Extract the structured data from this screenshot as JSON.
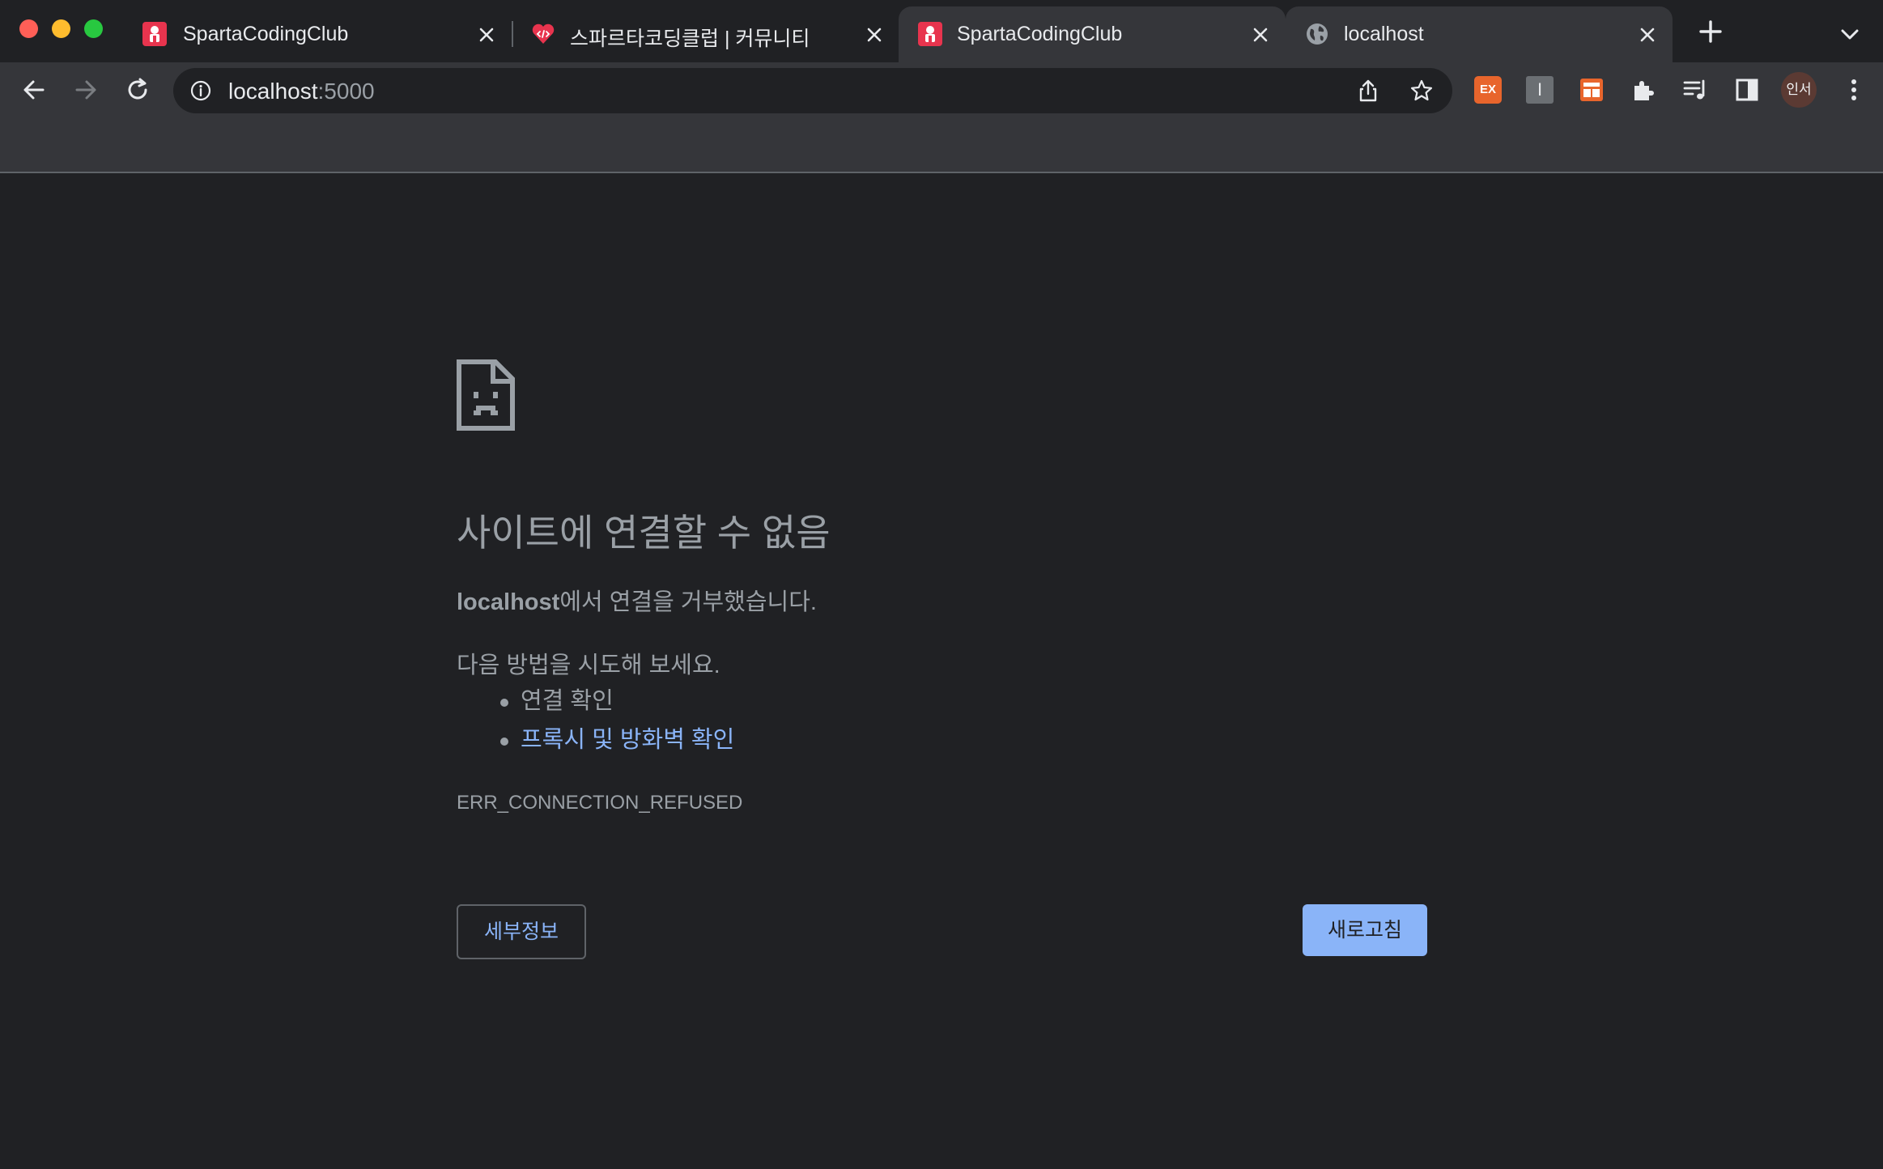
{
  "browser": {
    "tabs": [
      {
        "title": "SpartaCodingClub",
        "icon": "sparta-favicon-icon",
        "active": false
      },
      {
        "title": "스파르타코딩클럽 | 커뮤니티",
        "icon": "community-favicon-icon",
        "active": false
      },
      {
        "title": "SpartaCodingClub",
        "icon": "sparta-favicon-icon",
        "active": false
      },
      {
        "title": "localhost",
        "icon": "globe-icon",
        "active": true
      }
    ],
    "omnibox": {
      "host": "localhost",
      "port": ":5000"
    },
    "extensions": {
      "ex_label": "EX",
      "i_label": "I"
    },
    "profile_label": "인서"
  },
  "error_page": {
    "heading": "사이트에 연결할 수 없음",
    "host": "localhost",
    "refused_text": "에서 연결을 거부했습니다.",
    "try_text": "다음 방법을 시도해 보세요.",
    "suggestions": [
      "연결 확인",
      "프록시 및 방화벽 확인"
    ],
    "error_code": "ERR_CONNECTION_REFUSED",
    "details_button": "세부정보",
    "reload_button": "새로고침"
  },
  "colors": {
    "background": "#202124",
    "toolbar": "#35363a",
    "link": "#8ab4f8",
    "text": "#9aa0a6"
  }
}
